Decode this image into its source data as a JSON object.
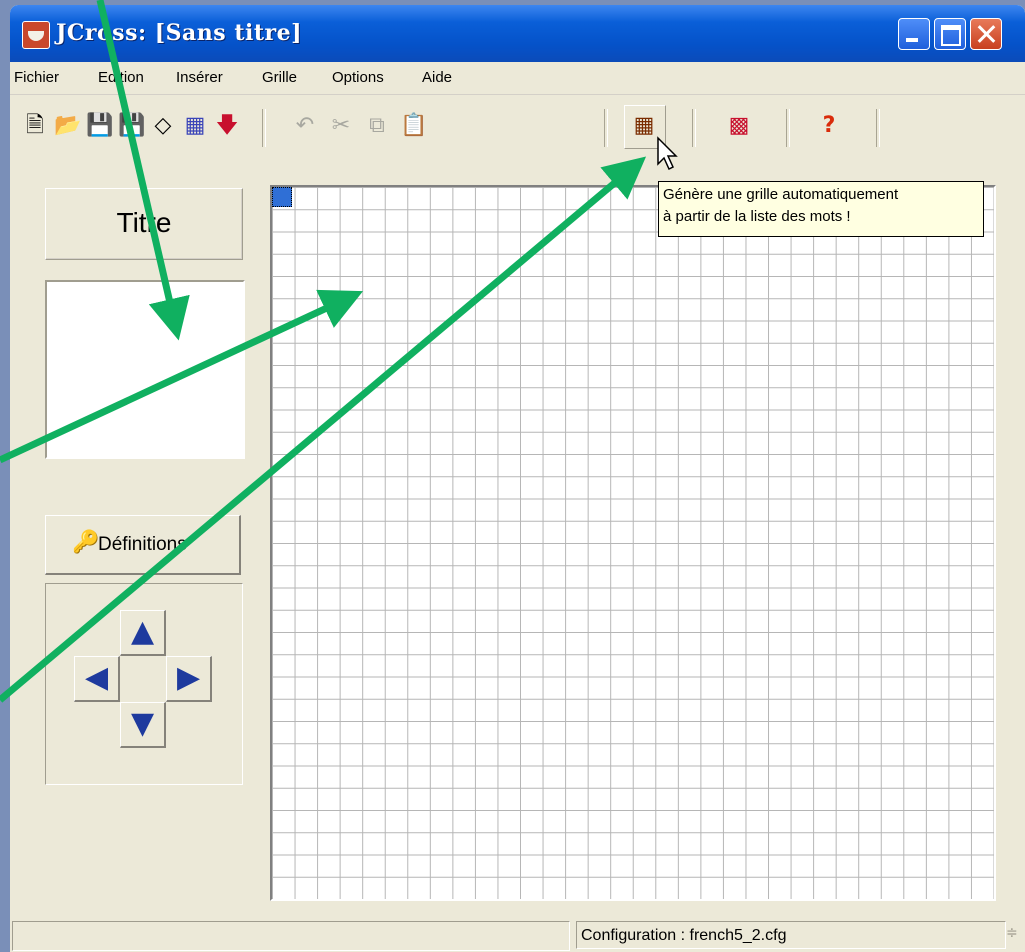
{
  "window": {
    "title": "JCross: [Sans titre]"
  },
  "menu": [
    "Fichier",
    "Edition",
    "Insérer",
    "Grille",
    "Options",
    "Aide"
  ],
  "toolbar": {
    "icons": {
      "new": "new-file-icon",
      "open": "open-folder-icon",
      "save": "save-icon",
      "save_as": "save-as-icon",
      "erase": "eraser-icon",
      "web": "web-export-icon",
      "import": "red-arrow-icon",
      "undo": "undo-icon",
      "cut": "cut-icon",
      "copy": "copy-icon",
      "paste": "paste-icon",
      "generate": "generate-grid-icon",
      "colors": "palette-icon",
      "help": "help-icon"
    }
  },
  "left_panel": {
    "titre_label": "Titre",
    "definitions_label": "Définitions"
  },
  "tooltip": {
    "line1": "Génère une grille automatiquement",
    "line2": "à partir de la liste des mots !"
  },
  "status": {
    "config": "Configuration : french5_2.cfg"
  },
  "grid": {
    "columns": 32,
    "rows": 32
  },
  "colors": {
    "annotation_arrow": "#10b060",
    "selected_cell": "#2f6fd6"
  }
}
